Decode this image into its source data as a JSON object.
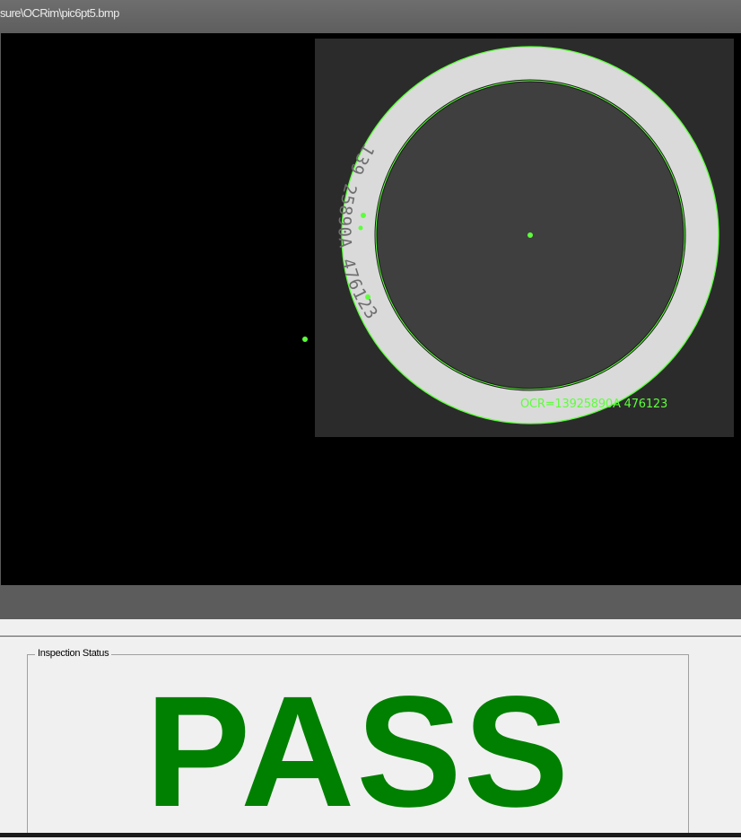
{
  "window": {
    "title": "sure\\OCRim\\pic6pt5.bmp"
  },
  "image": {
    "ring_text": "139 25890A 476123",
    "ocr_readout": "OCR=13925890A 476123",
    "colors": {
      "overlay": "#5cff3a",
      "panel_bg": "#2b2b2b",
      "ring": "#dadada",
      "disc": "#3f3f3f"
    }
  },
  "status": {
    "group_label": "Inspection Status",
    "result": "PASS",
    "result_color": "#008000"
  }
}
